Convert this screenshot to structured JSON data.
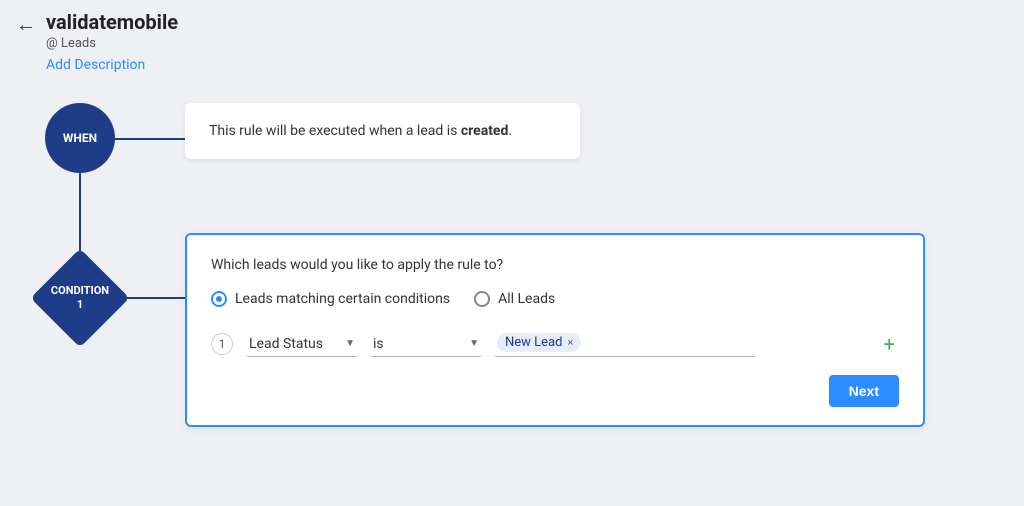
{
  "header": {
    "title": "validatemobile",
    "module_prefix": "@",
    "module": "Leads",
    "add_description": "Add Description"
  },
  "when_node": {
    "label": "WHEN"
  },
  "when_card": {
    "text_before": "This rule will be executed when a lead is ",
    "text_bold": "created",
    "text_after": "."
  },
  "condition_node": {
    "label": "CONDITION",
    "number": "1"
  },
  "condition_card": {
    "question": "Which leads would you like to apply the rule to?",
    "options": {
      "matching": "Leads matching certain conditions",
      "all": "All Leads",
      "selected": "matching"
    },
    "criteria": {
      "row_number": "1",
      "field": "Lead Status",
      "operator": "is",
      "value_chip": "New Lead"
    },
    "next_button": "Next"
  }
}
